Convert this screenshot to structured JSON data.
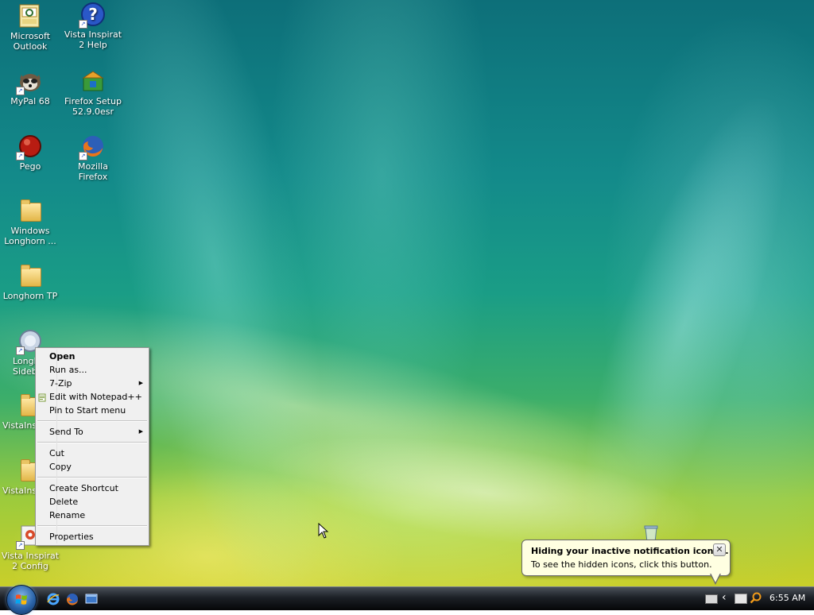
{
  "desktop_icons": [
    {
      "label": "Microsoft Outlook",
      "icon": "outlook-icon",
      "shortcut": false
    },
    {
      "label": "Vista Inspirat 2 Help",
      "icon": "help-icon",
      "shortcut": true
    },
    {
      "label": "MyPal 68",
      "icon": "mypal-icon",
      "shortcut": true
    },
    {
      "label": "Firefox Setup 52.9.0esr",
      "icon": "installer-icon",
      "shortcut": false
    },
    {
      "label": "Pego",
      "icon": "pego-icon",
      "shortcut": true
    },
    {
      "label": "Mozilla Firefox",
      "icon": "firefox-icon",
      "shortcut": true
    },
    {
      "label": "Windows Longhorn ...",
      "icon": "folder-icon",
      "shortcut": false
    },
    {
      "label": "Longhorn TP",
      "icon": "folder-icon",
      "shortcut": false
    },
    {
      "label": "Longh Sideb",
      "icon": "sidebar-icon",
      "shortcut": true
    },
    {
      "label": "VistaInsp",
      "icon": "folder-icon",
      "shortcut": false
    },
    {
      "label": "VistaInsp",
      "icon": "folder-icon",
      "shortcut": false
    },
    {
      "label": "Vista Inspirat 2 Config",
      "icon": "config-icon",
      "shortcut": true
    },
    {
      "label": "",
      "icon": "recycle-bin-icon",
      "shortcut": false
    }
  ],
  "context_menu": {
    "items": [
      {
        "label": "Open",
        "bold": true,
        "submenu": false,
        "icon": ""
      },
      {
        "label": "Run as...",
        "bold": false,
        "submenu": false,
        "icon": ""
      },
      {
        "label": "7-Zip",
        "bold": false,
        "submenu": true,
        "icon": ""
      },
      {
        "label": "Edit with Notepad++",
        "bold": false,
        "submenu": false,
        "icon": "notepad-plus-plus-icon"
      },
      {
        "label": "Pin to Start menu",
        "bold": false,
        "submenu": false,
        "icon": ""
      },
      {
        "separator": true
      },
      {
        "label": "Send To",
        "bold": false,
        "submenu": true,
        "icon": ""
      },
      {
        "separator": true
      },
      {
        "label": "Cut",
        "bold": false,
        "submenu": false,
        "icon": ""
      },
      {
        "label": "Copy",
        "bold": false,
        "submenu": false,
        "icon": ""
      },
      {
        "separator": true
      },
      {
        "label": "Create Shortcut",
        "bold": false,
        "submenu": false,
        "icon": ""
      },
      {
        "label": "Delete",
        "bold": false,
        "submenu": false,
        "icon": ""
      },
      {
        "label": "Rename",
        "bold": false,
        "submenu": false,
        "icon": ""
      },
      {
        "separator": true
      },
      {
        "label": "Properties",
        "bold": false,
        "submenu": false,
        "icon": ""
      }
    ]
  },
  "notification_balloon": {
    "title": "Hiding your inactive notification icons...",
    "text": "To see the hidden icons, click this button.",
    "close_glyph": "✕"
  },
  "taskbar": {
    "start_button_icon": "windows-logo-icon",
    "quick_launch": [
      "internet-explorer-icon",
      "firefox-icon",
      "show-desktop-icon"
    ],
    "tray_icons": [
      "keyboard-icon",
      "expand-tray-icon",
      "network-icon",
      "search-icon"
    ],
    "clock": "6:55 AM"
  },
  "colors": {
    "menu_background": "#f0f0f0",
    "balloon_background": "#ffffe1",
    "taskbar_dark": "#050607"
  }
}
